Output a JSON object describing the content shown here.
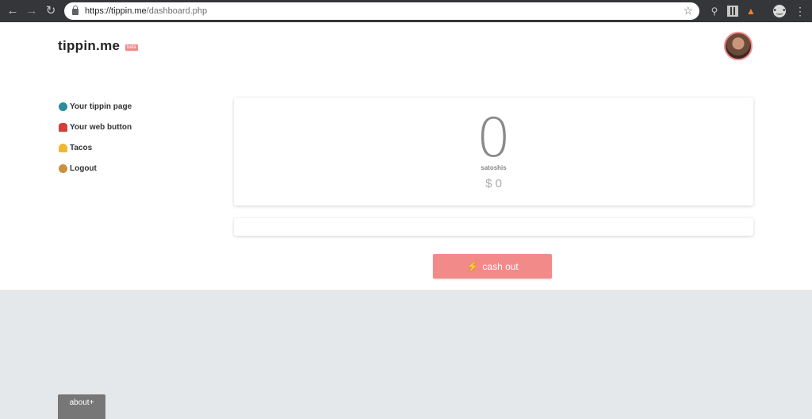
{
  "browser": {
    "url_host": "https://tippin.me",
    "url_path": "/dashboard.php"
  },
  "header": {
    "logo": "tippin.me",
    "badge": "beta"
  },
  "sidebar": {
    "items": [
      {
        "label": "Your tippin page",
        "icon": "globe-icon"
      },
      {
        "label": "Your web button",
        "icon": "siren-icon"
      },
      {
        "label": "Tacos",
        "icon": "taco-icon"
      },
      {
        "label": "Logout",
        "icon": "monkey-icon"
      }
    ]
  },
  "balance": {
    "amount": "0",
    "unit": "satoshis",
    "fiat": "$ 0"
  },
  "actions": {
    "cashout_label": "cash out"
  },
  "footer": {
    "about_label": "about+"
  },
  "colors": {
    "accent": "#f28a8a",
    "footer_bg": "#e5e8eb"
  }
}
